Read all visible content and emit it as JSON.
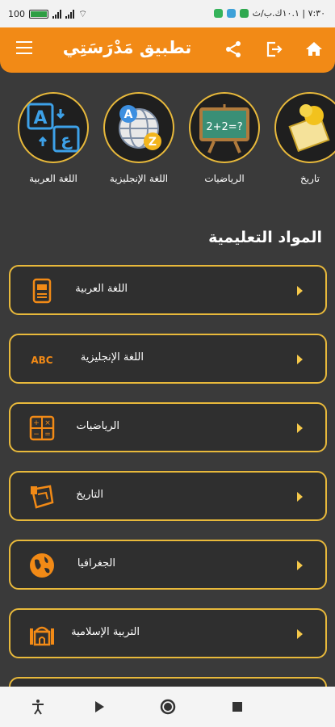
{
  "status_bar": {
    "battery": "100",
    "time": "٧:٣٠ | ١٠.١ك.ب/ث"
  },
  "header": {
    "title": "تطبيق مَدْرَسَتِي",
    "menu_icon": "hamburger-menu-icon",
    "share_icon": "share-icon",
    "logout_icon": "logout-icon",
    "home_icon": "home-icon",
    "color": "#f28a16"
  },
  "categories": [
    {
      "label": "اللغة العربية",
      "icon": "arabic-letters-icon"
    },
    {
      "label": "اللغة الإنجليزية",
      "icon": "a-to-z-globe-icon"
    },
    {
      "label": "الرياضيات",
      "icon": "chalkboard-math-icon"
    },
    {
      "label": "تاريخ",
      "icon": "scroll-coin-icon"
    }
  ],
  "section_title": "المواد التعليمية",
  "subjects": [
    {
      "label": "اللغة العربية",
      "icon": "book-icon"
    },
    {
      "label": "اللغة الإنجليزية",
      "icon": "abc-icon"
    },
    {
      "label": "الرياضيات",
      "icon": "calculator-icon"
    },
    {
      "label": "التاريخ",
      "icon": "history-scroll-icon"
    },
    {
      "label": "الجغرافيا",
      "icon": "globe-icon"
    },
    {
      "label": "التربية الإسلامية",
      "icon": "mosque-icon"
    }
  ],
  "accent_color": "#e8b93b",
  "nav": [
    "accessibility-icon",
    "play-icon",
    "home-circle-icon",
    "stop-square-icon"
  ]
}
